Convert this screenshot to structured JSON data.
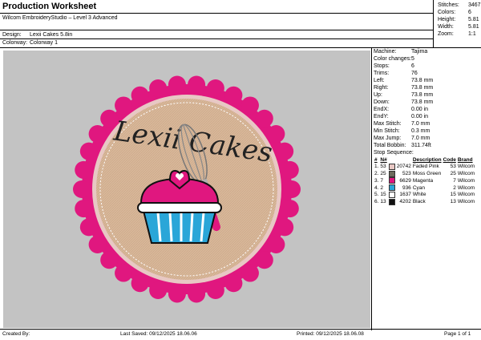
{
  "header": {
    "title": "Production Worksheet",
    "software": "Wilcom EmbroideryStudio – Level 3 Advanced",
    "design_label": "Design:",
    "design_value": "Lexii Cakes 5.8in",
    "colorway_label": "Colorway:",
    "colorway_value": "Colorway 1"
  },
  "summary": [
    {
      "label": "Stitches:",
      "value": "34671"
    },
    {
      "label": "Colors:",
      "value": "6"
    },
    {
      "label": "Height:",
      "value": "5.81 in"
    },
    {
      "label": "Width:",
      "value": "5.81 in"
    },
    {
      "label": "Zoom:",
      "value": "1:1"
    }
  ],
  "details": [
    {
      "label": "Machine:",
      "value": "Tajima"
    },
    {
      "label": "Color changes:",
      "value": "5"
    },
    {
      "label": "Stops:",
      "value": "6"
    },
    {
      "label": "Trims:",
      "value": "76"
    },
    {
      "label": "Left:",
      "value": "73.8 mm"
    },
    {
      "label": "Right:",
      "value": "73.8 mm"
    },
    {
      "label": "Up:",
      "value": "73.8 mm"
    },
    {
      "label": "Down:",
      "value": "73.8 mm"
    },
    {
      "label": "EndX:",
      "value": "0.00 in"
    },
    {
      "label": "EndY:",
      "value": "0.00 in"
    },
    {
      "label": "Max Stitch:",
      "value": "7.0 mm"
    },
    {
      "label": "Min Stitch:",
      "value": "0.3 mm"
    },
    {
      "label": "Max Jump:",
      "value": "7.0 mm"
    },
    {
      "label": "Total Bobbin:",
      "value": "311.74ft"
    }
  ],
  "stop_sequence": {
    "title": "Stop Sequence:",
    "columns": [
      "#",
      "N#",
      "",
      "Description",
      "Code",
      "Brand"
    ],
    "rows": [
      {
        "num": "1.",
        "n": "53",
        "code_num": "20742",
        "desc": "Faded Pink",
        "code": "53",
        "brand": "Wilcom",
        "color": "#e8c8c4"
      },
      {
        "num": "2.",
        "n": "25",
        "code_num": "523",
        "desc": "Moss Green",
        "code": "25",
        "brand": "Wilcom",
        "color": "#6b6a5c"
      },
      {
        "num": "3.",
        "n": "7",
        "code_num": "6629",
        "desc": "Magenta",
        "code": "7",
        "brand": "Wilcom",
        "color": "#e0177f"
      },
      {
        "num": "4.",
        "n": "2",
        "code_num": "936",
        "desc": "Cyan",
        "code": "2",
        "brand": "Wilcom",
        "color": "#2aa6d8"
      },
      {
        "num": "5.",
        "n": "15",
        "code_num": "1637",
        "desc": "White",
        "code": "15",
        "brand": "Wilcom",
        "color": "#ffffff"
      },
      {
        "num": "6.",
        "n": "13",
        "code_num": "4202",
        "desc": "Black",
        "code": "13",
        "brand": "Wilcom",
        "color": "#111111"
      }
    ]
  },
  "artwork": {
    "text": "Lexii Cakes",
    "colors": {
      "rim": "#e0177f",
      "fill": "#d9b99a",
      "cup": "#2aa6d8",
      "frost": "#e0177f",
      "text": "#222222",
      "whisk": "#e0177f"
    }
  },
  "footer": {
    "created_by": "Created By:",
    "last_saved": "Last Saved: 09/12/2025 18.06.06",
    "printed": "Printed: 09/12/2025 18.06.08",
    "page": "Page 1 of 1"
  }
}
